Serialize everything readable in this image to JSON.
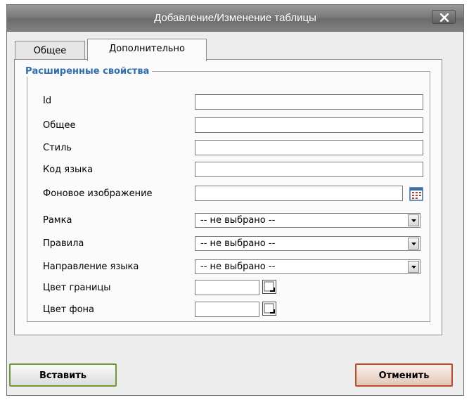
{
  "dialog": {
    "title": "Добавление/Изменение таблицы",
    "close_label": "×"
  },
  "tabs": [
    {
      "label": "Общее",
      "active": false
    },
    {
      "label": "Дополнительно",
      "active": true
    }
  ],
  "advanced": {
    "legend": "Расширенные свойства",
    "fields": {
      "id": {
        "label": "Id",
        "value": ""
      },
      "general": {
        "label": "Общее",
        "value": ""
      },
      "style": {
        "label": "Стиль",
        "value": ""
      },
      "lang_code": {
        "label": "Код языка",
        "value": ""
      },
      "background_image": {
        "label": "Фоновое изображение",
        "value": ""
      },
      "frame": {
        "label": "Рамка",
        "value": "-- не выбрано --"
      },
      "rules": {
        "label": "Правила",
        "value": "-- не выбрано --"
      },
      "lang_dir": {
        "label": "Направление языка",
        "value": "-- не выбрано --"
      },
      "border_color": {
        "label": "Цвет границы",
        "value": ""
      },
      "background_color": {
        "label": "Цвет фона",
        "value": ""
      }
    }
  },
  "buttons": {
    "insert": "Вставить",
    "cancel": "Отменить"
  },
  "colors": {
    "legend": "#2f6eb5",
    "insert_border": "#6e9a32",
    "cancel_border": "#c24a2a"
  },
  "icons": {
    "close": "close-icon",
    "browse": "browse-icon",
    "dropdown": "chevron-down-icon",
    "color_picker": "color-picker-icon"
  }
}
